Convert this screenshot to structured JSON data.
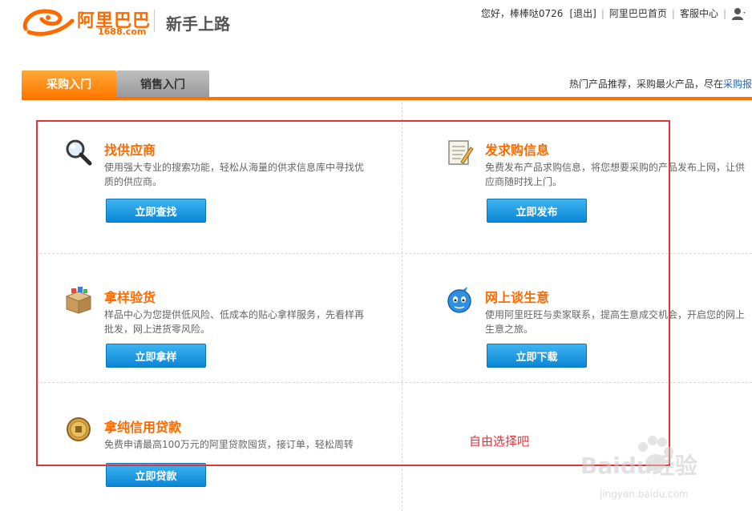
{
  "header": {
    "logo_main": "阿里巴巴",
    "logo_sub": "1688.com",
    "page_heading": "新手上路",
    "greeting": "您好，棒棒哒0726",
    "logout": "[退出]",
    "home_link": "阿里巴巴首页",
    "service_link": "客服中心"
  },
  "tabs": [
    {
      "label": "采购入门",
      "active": true
    },
    {
      "label": "销售入门",
      "active": false
    }
  ],
  "hot": {
    "text": "热门产品推荐，采购最火产品，尽在",
    "link": "采购报"
  },
  "cells": [
    {
      "title": "找供应商",
      "desc": "使用强大专业的搜索功能，轻松从海量的供求信息库中寻找优质的供应商。",
      "button": "立即查找",
      "icon": "magnifier-icon"
    },
    {
      "title": "发求购信息",
      "desc": "免费发布产品求购信息，将您想要采购的产品发布上网，让供应商随时找上门。",
      "button": "立即发布",
      "icon": "notepad-icon"
    },
    {
      "title": "拿样验货",
      "desc": "样品中心为您提供低风险、低成本的贴心拿样服务，先看样再批发，网上进货零风险。",
      "button": "立即拿样",
      "icon": "box-icon"
    },
    {
      "title": "网上谈生意",
      "desc": "使用阿里旺旺与卖家联系，提高生意成交机会，开启您的网上生意之旅。",
      "button": "立即下载",
      "icon": "wangwang-icon"
    },
    {
      "title": "拿纯信用贷款",
      "desc": "免费申请最高100万元的阿里贷款囤货，接订单，轻松周转",
      "button": "立即贷款",
      "icon": "coin-icon"
    }
  ],
  "annotation": "自由选择吧",
  "watermark": {
    "text": "Baidu经验",
    "sub": "jingyan.baidu.com"
  },
  "colors": {
    "brand_orange": "#ff6a00",
    "button_blue": "#0a86d6",
    "annotation_red": "#e0353d"
  }
}
